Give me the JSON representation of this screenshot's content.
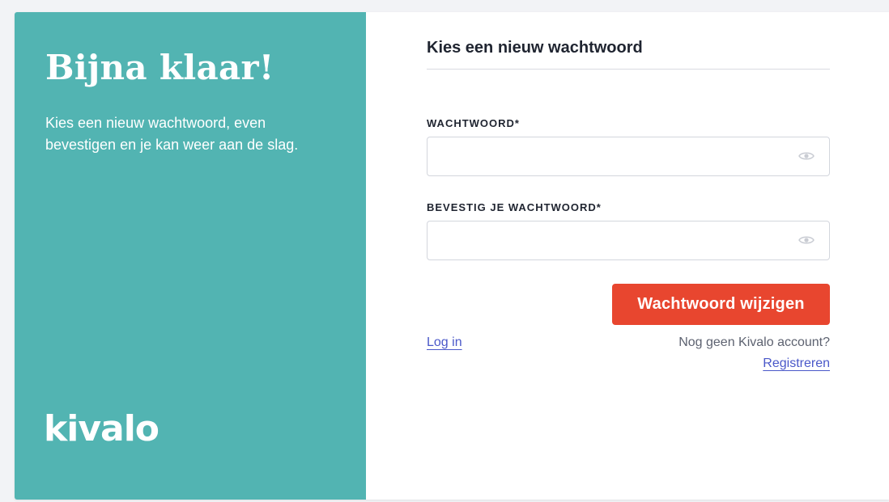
{
  "left_panel": {
    "heading": "Bijna klaar!",
    "subtitle": "Kies een nieuw wachtwoord, even bevestigen en je kan weer aan de slag.",
    "logo_text": "kivalo",
    "background_color": "#52b4b2"
  },
  "form": {
    "title": "Kies een nieuw wachtwoord",
    "password_label": "WACHTWOORD*",
    "password_value": "",
    "confirm_label": "BEVESTIG JE WACHTWOORD*",
    "confirm_value": "",
    "visibility_icon": "eye-icon",
    "submit_label": "Wachtwoord wijzigen",
    "submit_color": "#e8462f"
  },
  "footer": {
    "login_link": "Log in",
    "no_account_text": "Nog geen Kivalo account?",
    "register_link": "Registreren",
    "link_color": "#4a58c9"
  }
}
